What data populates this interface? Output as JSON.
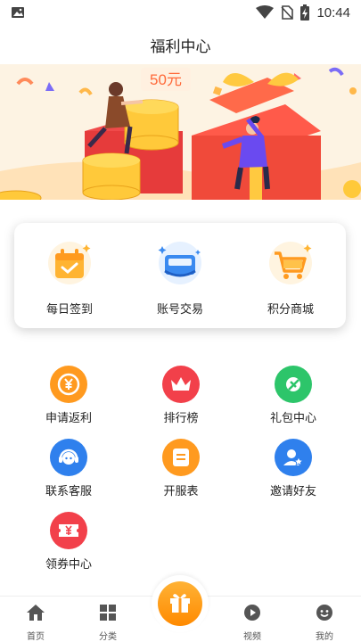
{
  "status_bar": {
    "time": "10:44",
    "icons": [
      "image-icon",
      "wifi-icon",
      "no-sim-icon",
      "battery-charging-icon"
    ]
  },
  "header": {
    "title": "福利中心"
  },
  "banner": {
    "badge_text": "50元"
  },
  "quick_actions": [
    {
      "label": "每日签到",
      "icon": "calendar-check-icon"
    },
    {
      "label": "账号交易",
      "icon": "account-trade-icon"
    },
    {
      "label": "积分商城",
      "icon": "shopping-cart-icon"
    }
  ],
  "services": [
    {
      "label": "申请返利",
      "icon": "yuan-coin-icon",
      "color": "#ff9a1f"
    },
    {
      "label": "排行榜",
      "icon": "crown-icon",
      "color": "#f2404a"
    },
    {
      "label": "礼包中心",
      "icon": "gift-pack-icon",
      "color": "#2dc56a"
    },
    {
      "label": "联系客服",
      "icon": "headset-icon",
      "color": "#2f80ed"
    },
    {
      "label": "开服表",
      "icon": "schedule-icon",
      "color": "#ff9a1f"
    },
    {
      "label": "邀请好友",
      "icon": "invite-user-icon",
      "color": "#2f80ed"
    },
    {
      "label": "领券中心",
      "icon": "coupon-icon",
      "color": "#f2404a"
    }
  ],
  "tabbar": {
    "tabs": [
      {
        "label": "首页",
        "icon": "home-icon"
      },
      {
        "label": "分类",
        "icon": "category-icon"
      },
      {
        "label": "",
        "icon": "gift-icon"
      },
      {
        "label": "视频",
        "icon": "video-icon"
      },
      {
        "label": "我的",
        "icon": "profile-icon"
      }
    ],
    "active_color": "#ff9a1f"
  }
}
